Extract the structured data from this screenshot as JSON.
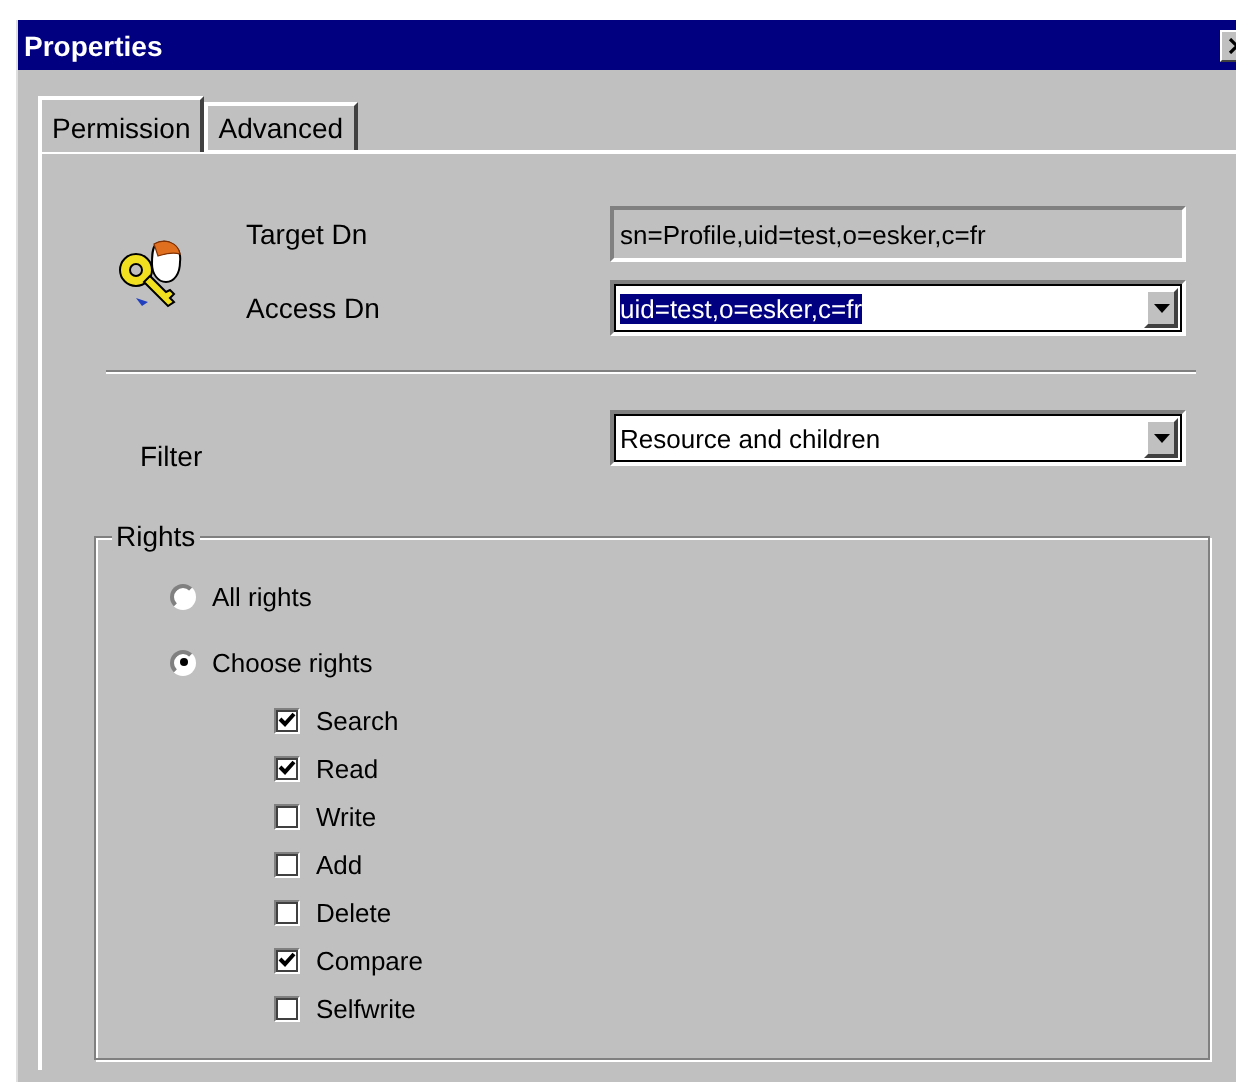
{
  "window": {
    "title": "Properties"
  },
  "tabs": [
    {
      "label": "Permission",
      "selected": true
    },
    {
      "label": "Advanced",
      "selected": false
    }
  ],
  "target_dn": {
    "label": "Target Dn",
    "value": "sn=Profile,uid=test,o=esker,c=fr",
    "disabled": true
  },
  "access_dn": {
    "label": "Access Dn",
    "value": "uid=test,o=esker,c=fr",
    "selected": true
  },
  "filter": {
    "label": "Filter",
    "value": "Resource and children"
  },
  "rights": {
    "title": "Rights",
    "options": [
      {
        "label": "All rights",
        "selected": false
      },
      {
        "label": "Choose rights",
        "selected": true
      }
    ],
    "items": [
      {
        "label": "Search",
        "checked": true
      },
      {
        "label": "Read",
        "checked": true
      },
      {
        "label": "Write",
        "checked": false
      },
      {
        "label": "Add",
        "checked": false
      },
      {
        "label": "Delete",
        "checked": false
      },
      {
        "label": "Compare",
        "checked": true
      },
      {
        "label": "Selfwrite",
        "checked": false
      }
    ]
  }
}
